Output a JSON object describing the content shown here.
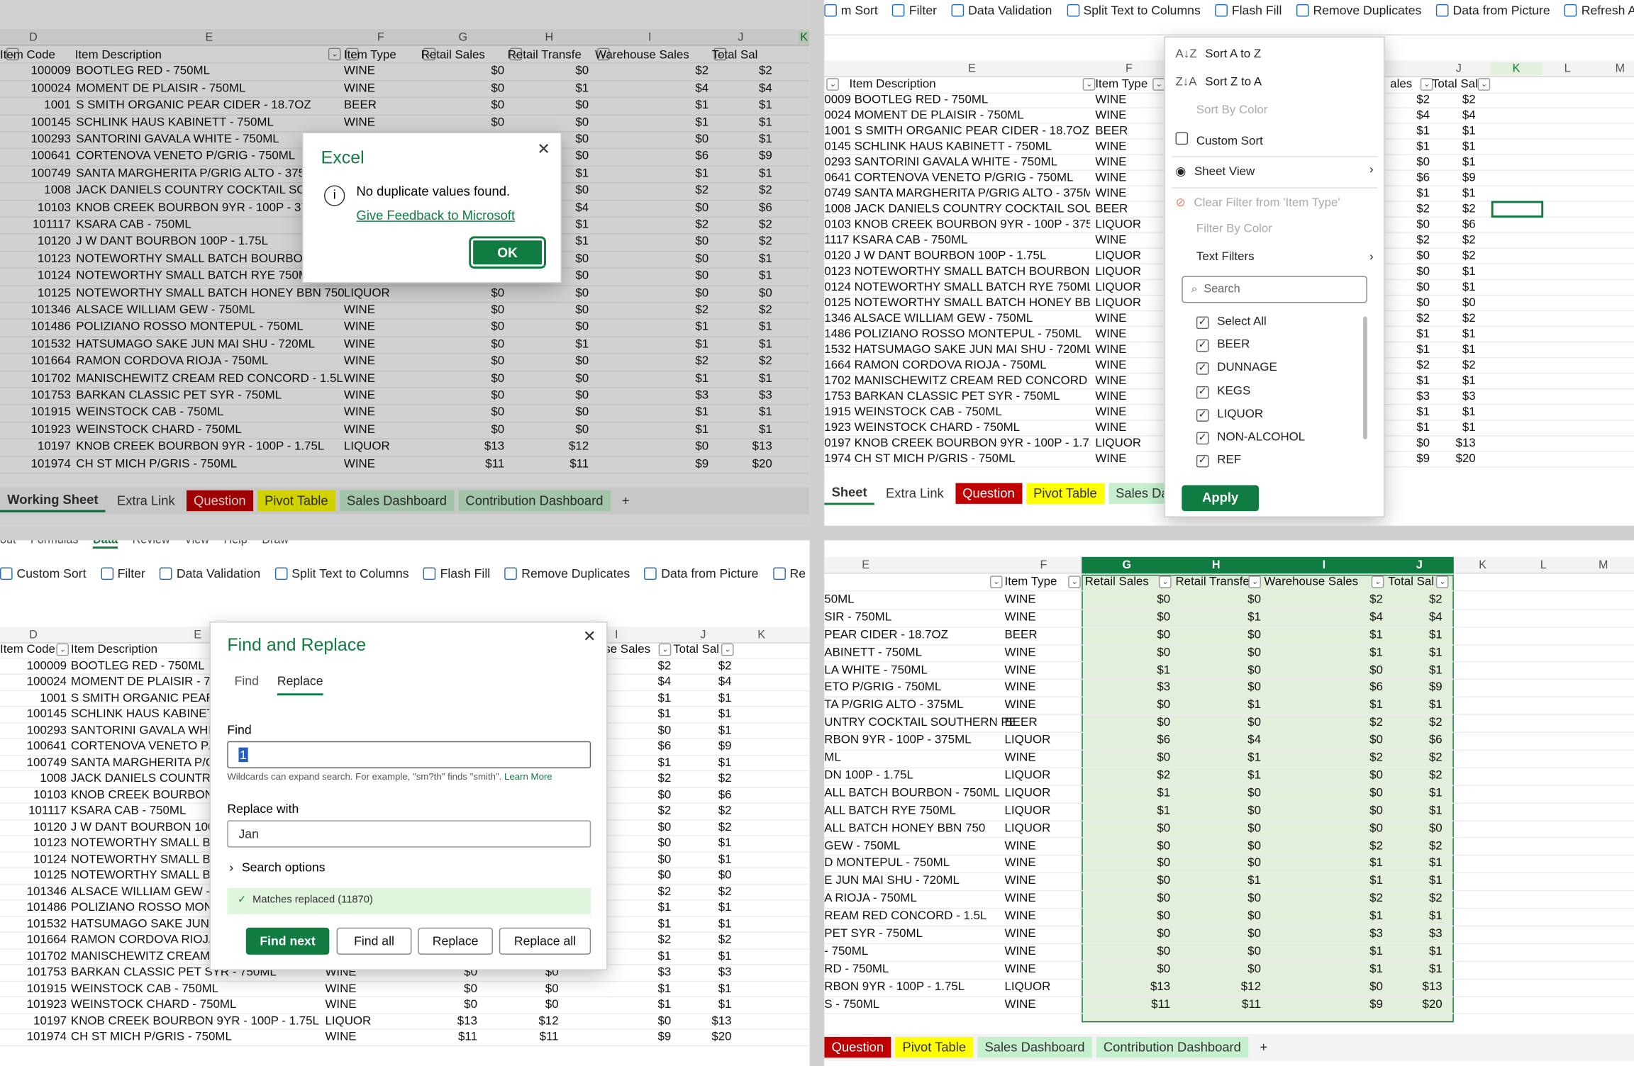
{
  "cols_q1": {
    "D": "D",
    "E": "E",
    "F": "F",
    "G": "G",
    "H": "H",
    "I": "I",
    "J": "J",
    "K": "K"
  },
  "headers": {
    "item_code": "Item Code",
    "item_desc": "Item Description",
    "item_type": "Item Type",
    "retail_sales": "Retail Sales",
    "retail_transfers": "Retail Transfe",
    "warehouse_sales": "Warehouse Sales",
    "total_sales": "Total Sal"
  },
  "rows": [
    {
      "code": "100009",
      "desc": "BOOTLEG RED - 750ML",
      "type": "WINE",
      "g": "$0",
      "h": "$0",
      "i": "$2",
      "j": "$2"
    },
    {
      "code": "100024",
      "desc": "MOMENT DE PLAISIR - 750ML",
      "type": "WINE",
      "g": "$0",
      "h": "$1",
      "i": "$4",
      "j": "$4"
    },
    {
      "code": "1001",
      "desc": "S SMITH ORGANIC PEAR CIDER - 18.7OZ",
      "type": "BEER",
      "g": "$0",
      "h": "$0",
      "i": "$1",
      "j": "$1"
    },
    {
      "code": "100145",
      "desc": "SCHLINK HAUS KABINETT - 750ML",
      "type": "WINE",
      "g": "$0",
      "h": "$0",
      "i": "$1",
      "j": "$1"
    },
    {
      "code": "100293",
      "desc": "SANTORINI GAVALA WHITE - 750ML",
      "type": "WINE",
      "g": "$1",
      "h": "$0",
      "i": "$0",
      "j": "$1"
    },
    {
      "code": "100641",
      "desc": "CORTENOVA VENETO P/GRIG - 750ML",
      "type": "WINE",
      "g": "$3",
      "h": "$0",
      "i": "$6",
      "j": "$9"
    },
    {
      "code": "100749",
      "desc": "SANTA MARGHERITA P/GRIG ALTO - 375ML",
      "type": "WINE",
      "g": "$0",
      "h": "$1",
      "i": "$1",
      "j": "$1"
    },
    {
      "code": "1008",
      "desc": "JACK DANIELS COUNTRY COCKTAIL SOUTHERN PE",
      "type": "BEER",
      "g": "$0",
      "h": "$0",
      "i": "$2",
      "j": "$2"
    },
    {
      "code": "10103",
      "desc": "KNOB CREEK BOURBON 9YR - 100P - 375ML",
      "type": "LIQUOR",
      "g": "$6",
      "h": "$4",
      "i": "$0",
      "j": "$6"
    },
    {
      "code": "101117",
      "desc": "KSARA CAB - 750ML",
      "type": "WINE",
      "g": "$0",
      "h": "$1",
      "i": "$2",
      "j": "$2"
    },
    {
      "code": "10120",
      "desc": "J W DANT BOURBON 100P - 1.75L",
      "type": "LIQUOR",
      "g": "$2",
      "h": "$1",
      "i": "$0",
      "j": "$2"
    },
    {
      "code": "10123",
      "desc": "NOTEWORTHY SMALL BATCH BOURBON - 750ML",
      "type": "LIQUOR",
      "g": "$1",
      "h": "$0",
      "i": "$0",
      "j": "$1"
    },
    {
      "code": "10124",
      "desc": "NOTEWORTHY SMALL BATCH RYE 750ML",
      "type": "LIQUOR",
      "g": "$1",
      "h": "$0",
      "i": "$0",
      "j": "$1"
    },
    {
      "code": "10125",
      "desc": "NOTEWORTHY SMALL BATCH HONEY BBN 750",
      "type": "LIQUOR",
      "g": "$0",
      "h": "$0",
      "i": "$0",
      "j": "$0"
    },
    {
      "code": "101346",
      "desc": "ALSACE WILLIAM GEW - 750ML",
      "type": "WINE",
      "g": "$0",
      "h": "$0",
      "i": "$2",
      "j": "$2"
    },
    {
      "code": "101486",
      "desc": "POLIZIANO ROSSO MONTEPUL - 750ML",
      "type": "WINE",
      "g": "$0",
      "h": "$0",
      "i": "$1",
      "j": "$1"
    },
    {
      "code": "101532",
      "desc": "HATSUMAGO SAKE JUN MAI SHU - 720ML",
      "type": "WINE",
      "g": "$0",
      "h": "$1",
      "i": "$1",
      "j": "$1"
    },
    {
      "code": "101664",
      "desc": "RAMON CORDOVA RIOJA - 750ML",
      "type": "WINE",
      "g": "$0",
      "h": "$0",
      "i": "$2",
      "j": "$2"
    },
    {
      "code": "101702",
      "desc": "MANISCHEWITZ CREAM RED CONCORD - 1.5L",
      "type": "WINE",
      "g": "$0",
      "h": "$0",
      "i": "$1",
      "j": "$1"
    },
    {
      "code": "101753",
      "desc": "BARKAN CLASSIC PET SYR - 750ML",
      "type": "WINE",
      "g": "$0",
      "h": "$0",
      "i": "$3",
      "j": "$3"
    },
    {
      "code": "101915",
      "desc": "WEINSTOCK CAB - 750ML",
      "type": "WINE",
      "g": "$0",
      "h": "$0",
      "i": "$1",
      "j": "$1"
    },
    {
      "code": "101923",
      "desc": "WEINSTOCK CHARD - 750ML",
      "type": "WINE",
      "g": "$0",
      "h": "$0",
      "i": "$1",
      "j": "$1"
    },
    {
      "code": "10197",
      "desc": "KNOB CREEK BOURBON 9YR - 100P - 1.75L",
      "type": "LIQUOR",
      "g": "$13",
      "h": "$12",
      "i": "$0",
      "j": "$13"
    },
    {
      "code": "101974",
      "desc": "CH ST MICH P/GRIS - 750ML",
      "type": "WINE",
      "g": "$11",
      "h": "$11",
      "i": "$9",
      "j": "$20"
    }
  ],
  "q4_desc": [
    "50ML",
    "SIR - 750ML",
    "PEAR CIDER - 18.7OZ",
    "ABINETT - 750ML",
    "LA WHITE - 750ML",
    "ETO P/GRIG - 750ML",
    "TA P/GRIG ALTO - 375ML",
    "UNTRY COCKTAIL SOUTHERN PE",
    "RBON 9YR - 100P - 375ML",
    "ML",
    "DN 100P - 1.75L",
    "ALL BATCH BOURBON - 750ML",
    "ALL BATCH RYE 750ML",
    "ALL BATCH HONEY BBN 750",
    "GEW - 750ML",
    "D MONTEPUL - 750ML",
    "E JUN MAI SHU - 720ML",
    "A RIOJA - 750ML",
    "REAM RED CONCORD - 1.5L",
    "PET SYR - 750ML",
    "- 750ML",
    "RD - 750ML",
    "RBON 9YR - 100P - 1.75L",
    "S - 750ML"
  ],
  "tabs_q1": [
    "Working Sheet",
    "Extra Link",
    "Question",
    "Pivot Table",
    "Sales Dashboard",
    "Contribution Dashboard",
    "+"
  ],
  "tabs_q2": [
    "Sheet",
    "Extra Link",
    "Question",
    "Pivot Table",
    "Sales Dashboard"
  ],
  "tabs_q4": [
    "Question",
    "Pivot Table",
    "Sales Dashboard",
    "Contribution Dashboard",
    "+"
  ],
  "excel_dialog": {
    "title": "Excel",
    "message": "No duplicate values found.",
    "link": "Give Feedback to Microsoft",
    "ok": "OK"
  },
  "ribbon_q2": [
    "m Sort",
    "Filter",
    "Data Validation",
    "Split Text to Columns",
    "Flash Fill",
    "Remove Duplicates",
    "Data from Picture",
    "Refresh All"
  ],
  "ribbon_q3": [
    "Custom Sort",
    "Filter",
    "Data Validation",
    "Split Text to Columns",
    "Flash Fill",
    "Remove Duplicates",
    "Data from Picture",
    "Re"
  ],
  "ribbon_q3_top": [
    "out",
    "Formulas",
    "Data",
    "Review",
    "View",
    "Help",
    "Draw"
  ],
  "filter_menu": {
    "sort_az": "Sort A to Z",
    "sort_za": "Sort Z to A",
    "sort_color": "Sort By Color",
    "custom_sort": "Custom Sort",
    "sheet_view": "Sheet View",
    "clear_filter": "Clear Filter from 'Item Type'",
    "filter_color": "Filter By Color",
    "text_filters": "Text Filters",
    "search_placeholder": "Search",
    "items": [
      "Select All",
      "BEER",
      "DUNNAGE",
      "KEGS",
      "LIQUOR",
      "NON-ALCOHOL",
      "REF"
    ],
    "apply": "Apply"
  },
  "find_replace": {
    "title": "Find and Replace",
    "tab_find": "Find",
    "tab_replace": "Replace",
    "find_label": "Find",
    "find_value": "1",
    "hint": "Wildcards can expand search. For example, \"sm?th\" finds \"smith\".",
    "learn_more": "Learn More",
    "replace_label": "Replace with",
    "replace_value": "Jan",
    "search_options": "Search options",
    "status": "Matches replaced (11870)",
    "btn_find_next": "Find next",
    "btn_find_all": "Find all",
    "btn_replace": "Replace",
    "btn_replace_all": "Replace all"
  },
  "accent": "#107c41"
}
